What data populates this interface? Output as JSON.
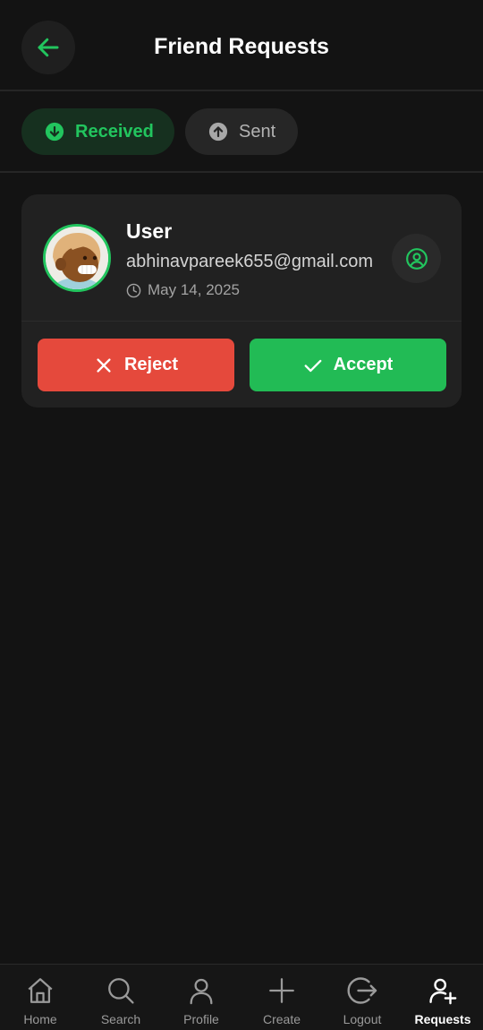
{
  "header": {
    "title": "Friend Requests",
    "back_icon": "arrow-left-icon"
  },
  "tabs": [
    {
      "label": "Received",
      "icon": "arrow-down-circle-icon",
      "active": true
    },
    {
      "label": "Sent",
      "icon": "arrow-up-circle-icon",
      "active": false
    }
  ],
  "requests": [
    {
      "name": "User",
      "email": "abhinavpareek655@gmail.com",
      "date": "May 14, 2025",
      "reject_label": "Reject",
      "accept_label": "Accept"
    }
  ],
  "bottom_nav": [
    {
      "label": "Home",
      "icon": "home-icon",
      "active": false
    },
    {
      "label": "Search",
      "icon": "search-icon",
      "active": false
    },
    {
      "label": "Profile",
      "icon": "user-icon",
      "active": false
    },
    {
      "label": "Create",
      "icon": "plus-icon",
      "active": false
    },
    {
      "label": "Logout",
      "icon": "logout-icon",
      "active": false
    },
    {
      "label": "Requests",
      "icon": "user-plus-icon",
      "active": true
    }
  ],
  "colors": {
    "background": "#131313",
    "accent": "#22c55e",
    "reject": "#e5493c",
    "accept": "#22bb55",
    "card": "#212121"
  }
}
